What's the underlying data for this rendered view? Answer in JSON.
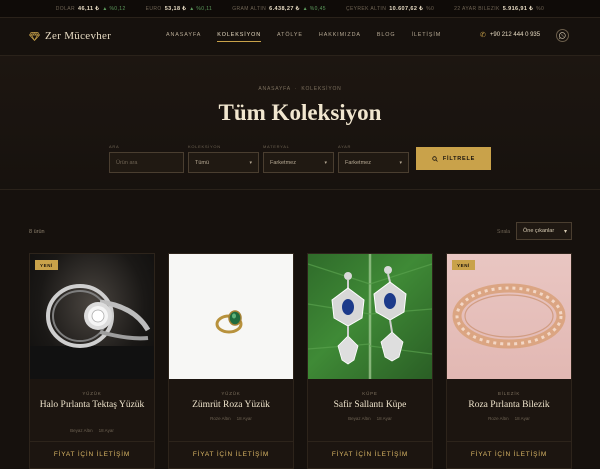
{
  "ticker": [
    {
      "label": "DOLAR",
      "value": "46,11 ₺",
      "change": "▲ %0,12",
      "dir": "up"
    },
    {
      "label": "EURO",
      "value": "53,18 ₺",
      "change": "▲ %0,11",
      "dir": "up"
    },
    {
      "label": "GRAM ALTIN",
      "value": "6.438,27 ₺",
      "change": "▲ %0,45",
      "dir": "up"
    },
    {
      "label": "ÇEYREK ALTIN",
      "value": "10.607,62 ₺",
      "change": "%0",
      "dir": "flat"
    },
    {
      "label": "22 AYAR BILEZIK",
      "value": "5.916,91 ₺",
      "change": "%0",
      "dir": "flat"
    }
  ],
  "header": {
    "logo_text": "Zer Mücevher",
    "nav": [
      "ANASAYFA",
      "KOLEKSİYON",
      "ATÖLYE",
      "HAKKIMIZDA",
      "BLOG",
      "İLETİŞİM"
    ],
    "active_nav": 1,
    "phone": "+90 212 444 0 935"
  },
  "hero": {
    "breadcrumb": [
      "ANASAYFA",
      "KOLEKSİYON"
    ],
    "title": "Tüm Koleksiyon"
  },
  "filters": {
    "search": {
      "label": "ARA",
      "placeholder": "Ürün ara"
    },
    "collection": {
      "label": "KOLEKSİYON",
      "value": "Tümü"
    },
    "material": {
      "label": "MATERYAL",
      "value": "Farketmez"
    },
    "karat": {
      "label": "AYAR",
      "value": "Farketmez"
    },
    "button_label": "FİLTRELE"
  },
  "toolbar": {
    "result_count": "8 ürün",
    "sort_label": "Sırala",
    "sort_value": "Öne çıkanlar"
  },
  "products": [
    {
      "badge": "YENİ",
      "category": "YÜZÜK",
      "name": "Halo Pırlanta Tektaş Yüzük",
      "material": "Beyaz Altın",
      "karat": "18 Ayar",
      "cta": "FİYAT İÇİN İLETİŞİM"
    },
    {
      "badge": "",
      "category": "YÜZÜK",
      "name": "Zümrüt Roza Yüzük",
      "material": "Roze Altın",
      "karat": "18 Ayar",
      "cta": "FİYAT İÇİN İLETİŞİM"
    },
    {
      "badge": "",
      "category": "KÜPE",
      "name": "Safir Sallantı Küpe",
      "material": "Beyaz Altın",
      "karat": "18 Ayar",
      "cta": "FİYAT İÇİN İLETİŞİM"
    },
    {
      "badge": "YENİ",
      "category": "BİLEZİK",
      "name": "Roza Pırlanta Bilezik",
      "material": "Roze Altın",
      "karat": "18 Ayar",
      "cta": "FİYAT İÇİN İLETİŞİM"
    }
  ],
  "colors": {
    "accent": "#c9a24a",
    "background": "#16110d",
    "text": "#e8dcc4"
  }
}
